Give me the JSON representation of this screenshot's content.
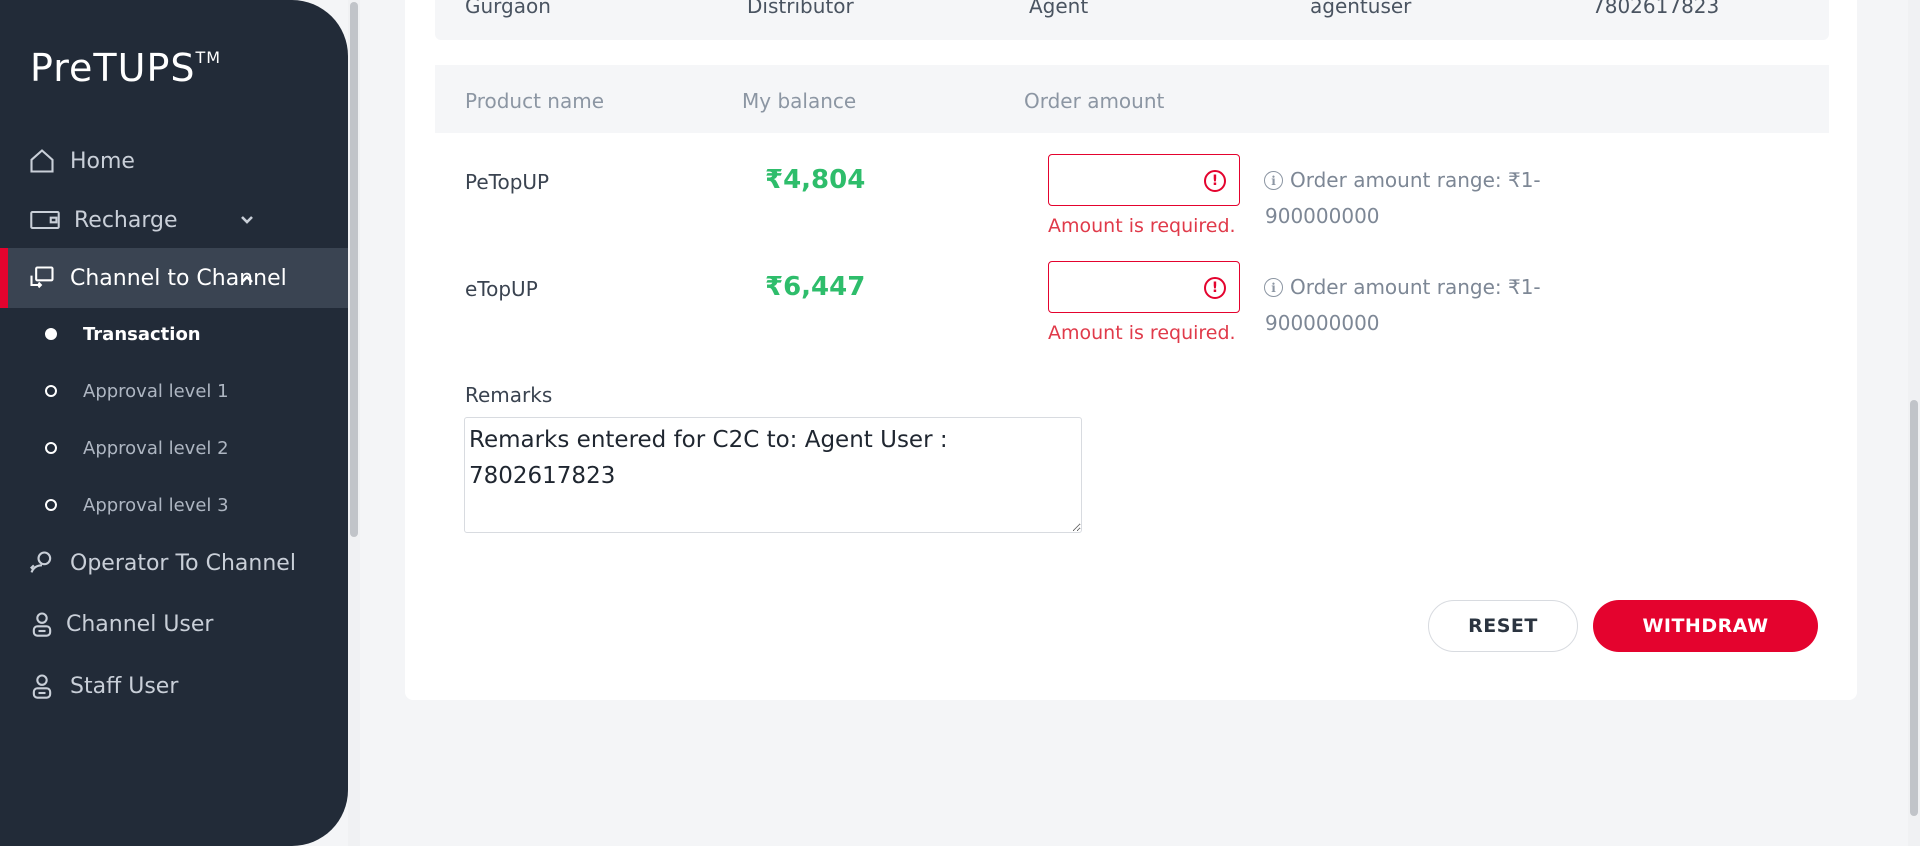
{
  "app": {
    "brand": "PreTUPS",
    "brand_mark": "TM"
  },
  "sidebar": {
    "items": [
      {
        "label": "Home",
        "icon": "home-icon"
      },
      {
        "label": "Recharge",
        "icon": "recharge-icon"
      },
      {
        "label": "Channel to Channel",
        "icon": "channel-icon",
        "active": true
      },
      {
        "label": "Operator To Channel",
        "icon": "operator-icon"
      },
      {
        "label": "Channel User",
        "icon": "user-icon"
      },
      {
        "label": "Staff User",
        "icon": "staff-icon"
      }
    ],
    "subitems": [
      {
        "label": "Transaction",
        "selected": true
      },
      {
        "label": "Approval level 1"
      },
      {
        "label": "Approval level 2"
      },
      {
        "label": "Approval level 3"
      }
    ]
  },
  "user_row": {
    "geography": "Gurgaon",
    "domain": "Distributor",
    "category": "Agent",
    "user_name": "agentuser",
    "msisdn": "7802617823"
  },
  "product_table": {
    "headers": {
      "product": "Product name",
      "balance": "My balance",
      "amount": "Order amount"
    },
    "rows": [
      {
        "product": "PeTopUP",
        "balance": "₹4,804",
        "amount_value": "",
        "error": "Amount is required.",
        "range_line1": "Order amount range: ₹1-",
        "range_line2": "900000000"
      },
      {
        "product": "eTopUP",
        "balance": "₹6,447",
        "amount_value": "",
        "error": "Amount is required.",
        "range_line1": "Order amount range: ₹1-",
        "range_line2": "900000000"
      }
    ]
  },
  "remarks": {
    "label": "Remarks",
    "value": "Remarks entered for C2C to: Agent User : 7802617823"
  },
  "actions": {
    "reset": "RESET",
    "withdraw": "WITHDRAW"
  },
  "colors": {
    "accent": "#e4032e",
    "sidebar_bg": "#222b38",
    "balance": "#2ebd6b",
    "error": "#e03a4a"
  }
}
